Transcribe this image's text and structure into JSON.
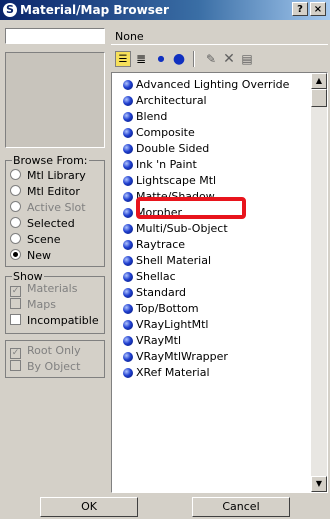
{
  "window": {
    "title": "Material/Map Browser",
    "help_button": "?",
    "close_button": "×"
  },
  "left_panel": {
    "name_field_value": "",
    "browse_from": {
      "label": "Browse From:",
      "options": [
        {
          "label": "Mtl Library",
          "selected": false,
          "enabled": true
        },
        {
          "label": "Mtl Editor",
          "selected": false,
          "enabled": true
        },
        {
          "label": "Active Slot",
          "selected": false,
          "enabled": false
        },
        {
          "label": "Selected",
          "selected": false,
          "enabled": true
        },
        {
          "label": "Scene",
          "selected": false,
          "enabled": true
        },
        {
          "label": "New",
          "selected": true,
          "enabled": true
        }
      ]
    },
    "show": {
      "label": "Show",
      "materials": "Materials",
      "maps": "Maps",
      "incompatible": "Incompatible"
    },
    "root_only": "Root Only",
    "by_object": "By Object"
  },
  "right_panel": {
    "current_value": "None",
    "materials": [
      "Advanced Lighting Override",
      "Architectural",
      "Blend",
      "Composite",
      "Double Sided",
      "Ink 'n Paint",
      "Lightscape Mtl",
      "Matte/Shadow",
      "Morpher",
      "Multi/Sub-Object",
      "Raytrace",
      "Shell Material",
      "Shellac",
      "Standard",
      "Top/Bottom",
      "VRayLightMtl",
      "VRayMtl",
      "VRayMtlWrapper",
      "XRef Material"
    ],
    "highlighted_item": "Multi/Sub-Object",
    "highlight_color": "#e8141c"
  },
  "buttons": {
    "ok": "OK",
    "cancel": "Cancel"
  }
}
